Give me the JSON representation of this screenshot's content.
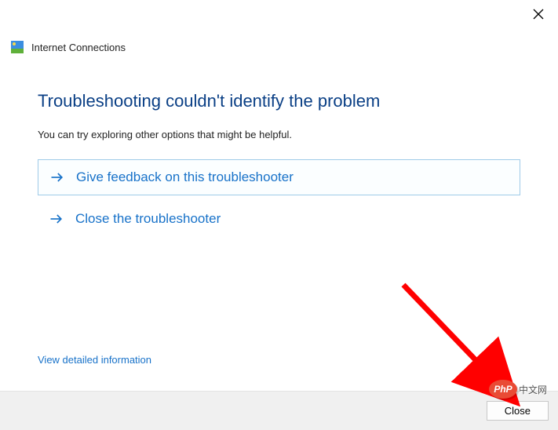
{
  "window": {
    "title": "Internet Connections"
  },
  "heading": "Troubleshooting couldn't identify the problem",
  "subtext": "You can try exploring other options that might be helpful.",
  "options": {
    "feedback": "Give feedback on this troubleshooter",
    "close_ts": "Close the troubleshooter"
  },
  "detail_link": "View detailed information",
  "footer": {
    "close_label": "Close"
  },
  "watermark": {
    "bubble": "PhP",
    "text": "中文网"
  }
}
